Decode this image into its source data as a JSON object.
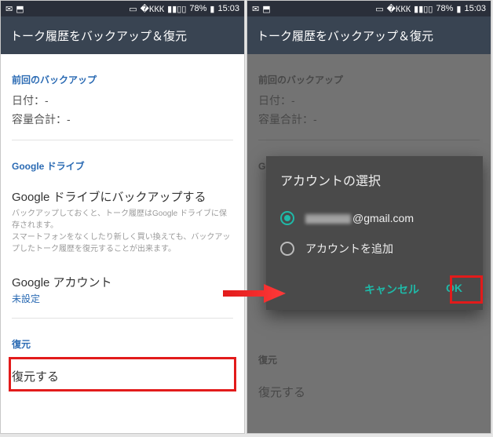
{
  "statusbar": {
    "battery": "78%",
    "time": "15:03"
  },
  "appbar": {
    "title": "トーク履歴をバックアップ＆復元"
  },
  "sections": {
    "last_backup_header": "前回のバックアップ",
    "date_label": "日付：-",
    "size_label": "容量合計：-",
    "drive_header": "Google ドライブ",
    "backup_title": "Google ドライブにバックアップする",
    "backup_sub": "バックアップしておくと、トーク履歴はGoogle ドライブに保存されます。\nスマートフォンをなくしたり新しく買い換えても、バックアップしたトーク履歴を復元することが出来ます。",
    "account_title": "Google アカウント",
    "account_status": "未設定",
    "restore_header": "復元",
    "restore_label": "復元する"
  },
  "dialog": {
    "title": "アカウントの選択",
    "email_suffix": "@gmail.com",
    "add_account": "アカウントを追加",
    "cancel": "キャンセル",
    "ok": "OK"
  }
}
